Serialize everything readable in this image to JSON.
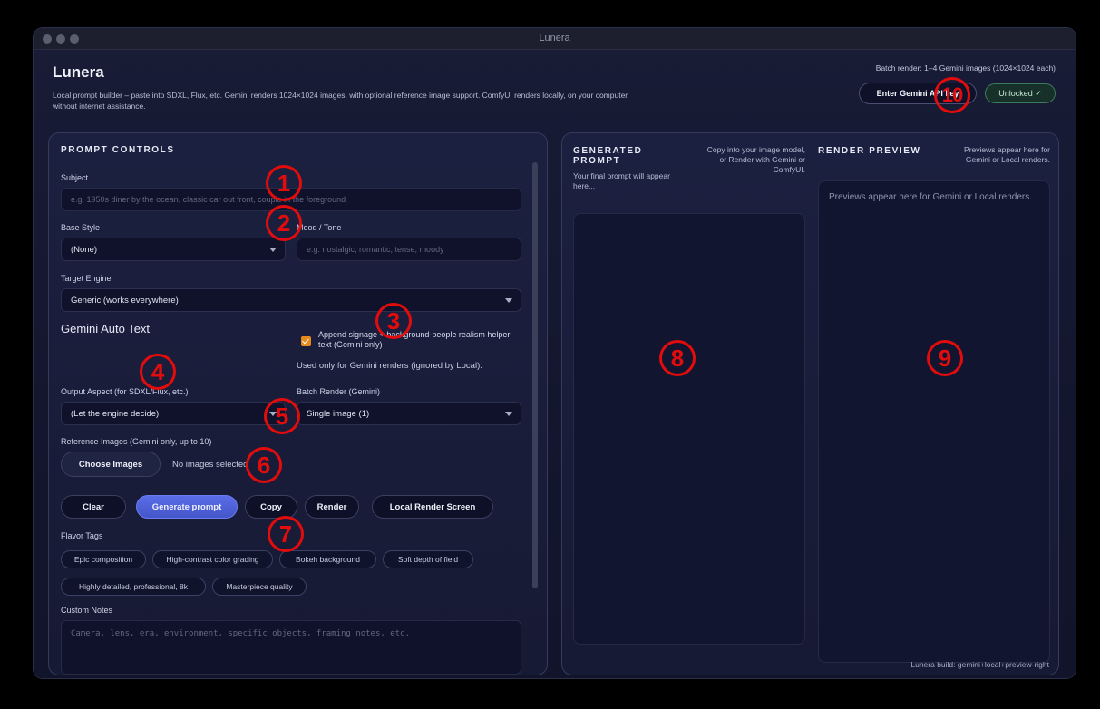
{
  "window": {
    "title": "Lunera"
  },
  "header": {
    "title": "Lunera",
    "description": "Local prompt builder – paste into SDXL, Flux, etc. Gemini renders 1024×1024 images, with optional reference image support. ComfyUI renders locally, on your computer without internet assistance.",
    "batch_note": "Batch render: 1–4 Gemini images (1024×1024 each)",
    "api_button": "Enter Gemini API key",
    "status_badge": "Unlocked ✓"
  },
  "controls": {
    "section_title": "PROMPT CONTROLS",
    "subject": {
      "label": "Subject",
      "placeholder": "e.g. 1950s diner by the ocean, classic car out front, couple in the foreground"
    },
    "base_style": {
      "label": "Base Style",
      "value": "(None)"
    },
    "mood": {
      "label": "Mood / Tone",
      "placeholder": "e.g. nostalgic, romantic, tense, moody"
    },
    "target_engine": {
      "label": "Target Engine",
      "value": "Generic (works everywhere)"
    },
    "gemini_auto": {
      "title": "Gemini Auto Text",
      "checkbox_label": "Append signage + background-people realism helper text (Gemini only)",
      "note": "Used only for Gemini renders (ignored by Local)."
    },
    "output_aspect": {
      "label": "Output Aspect (for SDXL/Flux, etc.)",
      "value": "(Let the engine decide)"
    },
    "batch_render": {
      "label": "Batch Render (Gemini)",
      "value": "Single image (1)"
    },
    "reference": {
      "label": "Reference Images (Gemini only, up to 10)",
      "button": "Choose Images",
      "status": "No images selected"
    },
    "actions": {
      "clear": "Clear",
      "generate": "Generate prompt",
      "copy": "Copy",
      "render": "Render",
      "local": "Local Render Screen"
    },
    "flavor": {
      "label": "Flavor Tags",
      "tags": [
        "Epic composition",
        "High-contrast color grading",
        "Bokeh background",
        "Soft depth of field",
        "Highly detailed, professional, 8k",
        "Masterpiece quality"
      ]
    },
    "notes": {
      "label": "Custom Notes",
      "placeholder": "Camera, lens, era, environment, specific objects, framing notes, etc."
    }
  },
  "generated": {
    "title_line1": "GENERATED",
    "title_line2": "PROMPT",
    "subtitle": "Your final prompt will appear here...",
    "hint": "Copy into your image model, or Render with Gemini or ComfyUI."
  },
  "preview": {
    "title": "RENDER PREVIEW",
    "hint": "Previews appear here for Gemini or Local renders.",
    "placeholder": "Previews appear here for Gemini or Local renders."
  },
  "build_note": "Lunera build: gemini+local+preview-right",
  "markers": [
    "1",
    "2",
    "3",
    "4",
    "5",
    "6",
    "7",
    "8",
    "9",
    "10"
  ],
  "colors": {
    "accent": "#5060dc",
    "marker": "#e30c0c",
    "checkbox": "#e68a1e",
    "success": "#3d7a5c"
  }
}
